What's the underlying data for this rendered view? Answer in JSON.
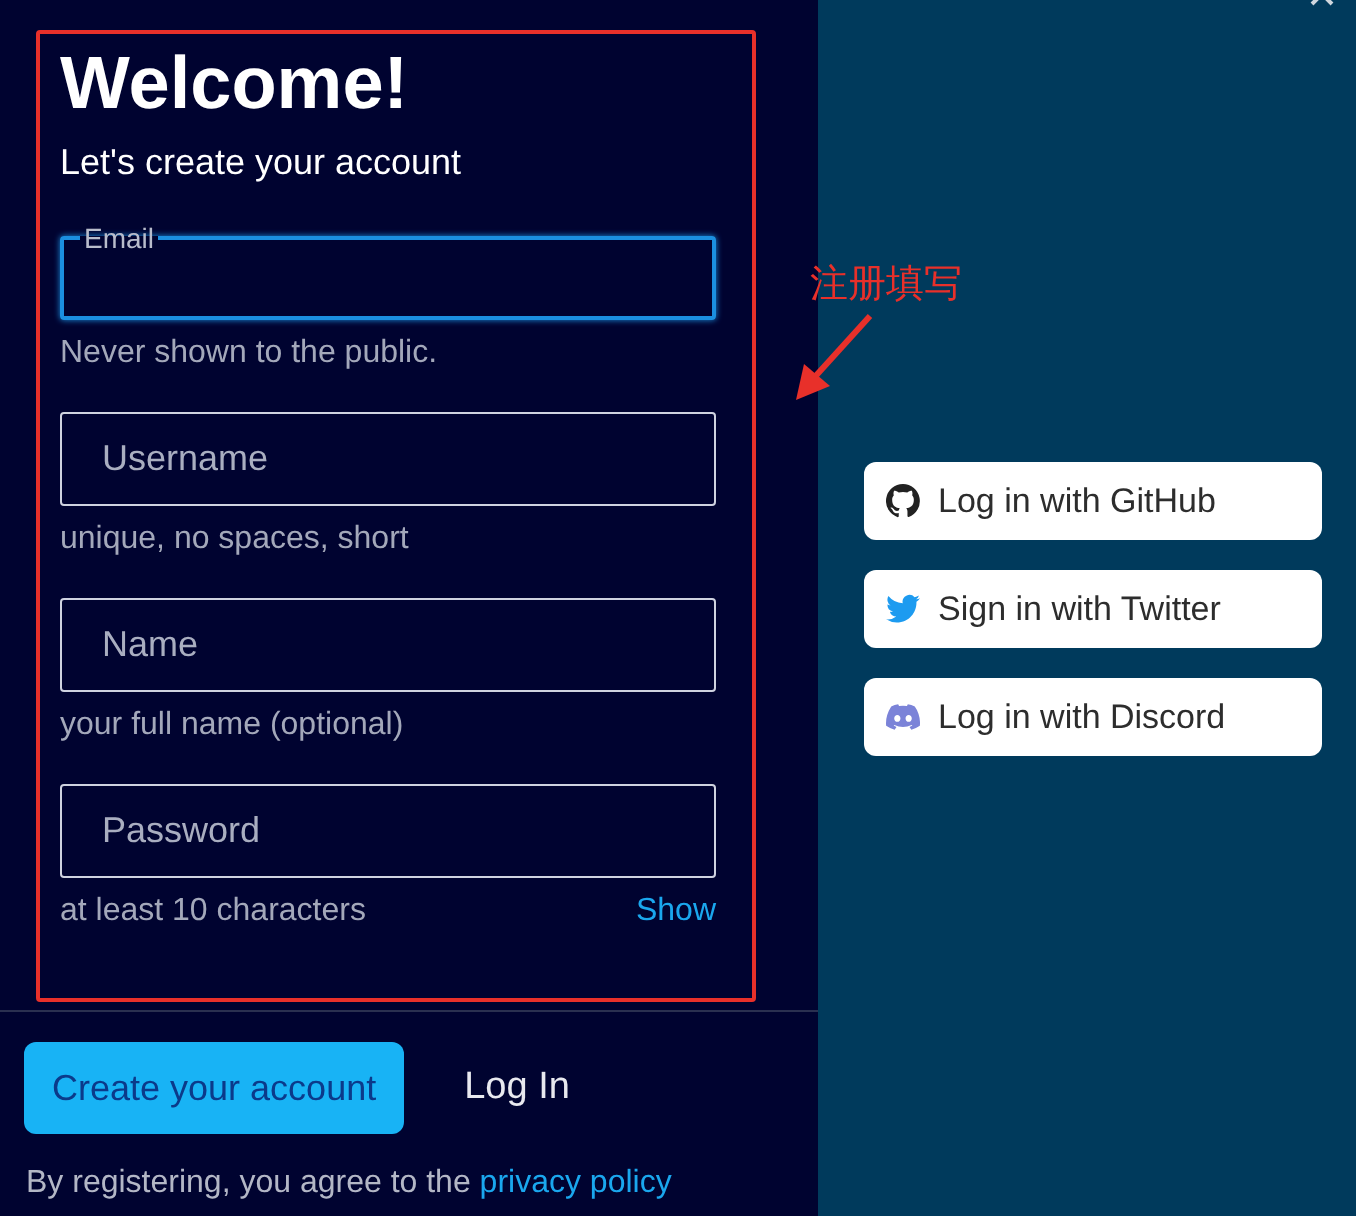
{
  "form": {
    "title": "Welcome!",
    "subtitle": "Let's create your account",
    "fields": [
      {
        "kind": "floating",
        "label": "Email",
        "focused": true,
        "hint": "Never shown to the public."
      },
      {
        "kind": "plain",
        "placeholder": "Username",
        "focused": false,
        "hint": "unique, no spaces, short"
      },
      {
        "kind": "plain",
        "placeholder": "Name",
        "focused": false,
        "hint": "your full name (optional)"
      },
      {
        "kind": "plain",
        "placeholder": "Password",
        "focused": false,
        "hint": "at least 10 characters",
        "action": "Show"
      }
    ]
  },
  "actions": {
    "primary": "Create your account",
    "secondary": "Log In"
  },
  "legal": {
    "text": "By registering, you agree to the",
    "link": "privacy policy"
  },
  "social": [
    {
      "kind": "github",
      "label": "Log in with GitHub"
    },
    {
      "kind": "twitter",
      "label": "Sign in with Twitter"
    },
    {
      "kind": "discord",
      "label": "Log in with Discord"
    }
  ],
  "annotation": {
    "label": "注册填写"
  }
}
